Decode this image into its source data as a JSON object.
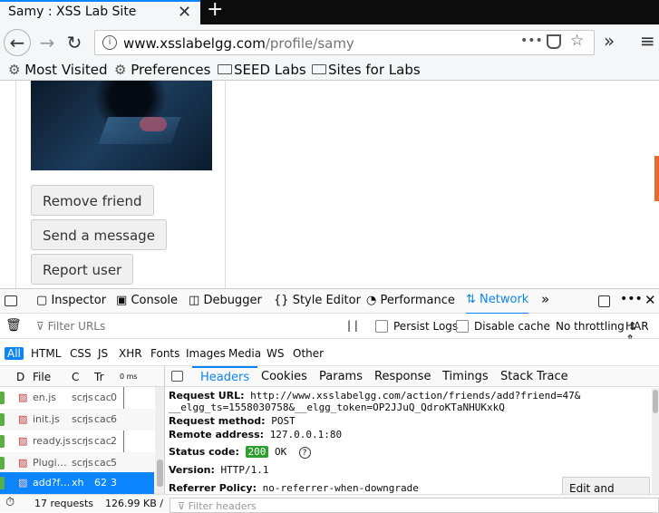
{
  "tab": {
    "title": "Samy : XSS Lab Site",
    "close": "✕",
    "new": "+"
  },
  "nav": {
    "back": "←",
    "forward": "→",
    "reload": "↻",
    "info": "i",
    "url_host": "www.xsslabelgg.com",
    "url_path": "/profile/samy",
    "more": "•••",
    "overflow": "»",
    "menu": "≡"
  },
  "bookmarks": [
    "Most Visited",
    "Preferences",
    "SEED Labs",
    "Sites for Labs"
  ],
  "profile": {
    "buttons": [
      "Remove friend",
      "Send a message",
      "Report user"
    ]
  },
  "devtools": {
    "tabs": [
      "Inspector",
      "Console",
      "Debugger",
      "Style Editor",
      "Performance",
      "Network"
    ],
    "active": "Network",
    "more": "»"
  },
  "filter": {
    "placeholder": "Filter URLs",
    "pause": "| |",
    "persist": "Persist Logs",
    "disable_cache": "Disable cache",
    "throttle": "No throttling ⇕",
    "har": "HAR ⇕"
  },
  "types": [
    "All",
    "HTML",
    "CSS",
    "JS",
    "XHR",
    "Fonts",
    "Images",
    "Media",
    "WS",
    "Other"
  ],
  "list_headers": [
    "D",
    "File",
    "C",
    "Tr",
    "0 ms"
  ],
  "rows": [
    {
      "file": "en.js",
      "cause": "scr",
      "type": "js",
      "tr": "cac",
      "size": "0"
    },
    {
      "file": "init.js",
      "cause": "scr",
      "type": "js",
      "tr": "cac",
      "size": "6"
    },
    {
      "file": "ready.js",
      "cause": "scr",
      "type": "js",
      "tr": "cac",
      "size": "2"
    },
    {
      "file": "Plugi…",
      "cause": "scr",
      "type": "js",
      "tr": "cac",
      "size": "5"
    },
    {
      "file": "add?f…",
      "cause": "xh",
      "type": "js",
      "tr": "62",
      "size": "3"
    }
  ],
  "detail_tabs": [
    "Headers",
    "Cookies",
    "Params",
    "Response",
    "Timings",
    "Stack Trace"
  ],
  "headers": {
    "req_url_k": "Request URL:",
    "req_url_v1": "http://www.xsslabelgg.com/action/friends/add?friend=47&",
    "req_url_v2": "__elgg_ts=1558030758&__elgg_token=OP2JJuQ_QdroKTaNHUKxkQ",
    "method_k": "Request method:",
    "method_v": "POST",
    "remote_k": "Remote address:",
    "remote_v": "127.0.0.1:80",
    "status_k": "Status code:",
    "status_code": "200",
    "status_text": "OK",
    "version_k": "Version:",
    "version_v": "HTTP/1.1",
    "referrer_k": "Referrer Policy:",
    "referrer_v": "no-referrer-when-downgrade",
    "resend": "Edit and Resend",
    "filter_headers": "Filter headers"
  },
  "status": {
    "requests": "17 requests",
    "size": "126.99 KB /"
  }
}
